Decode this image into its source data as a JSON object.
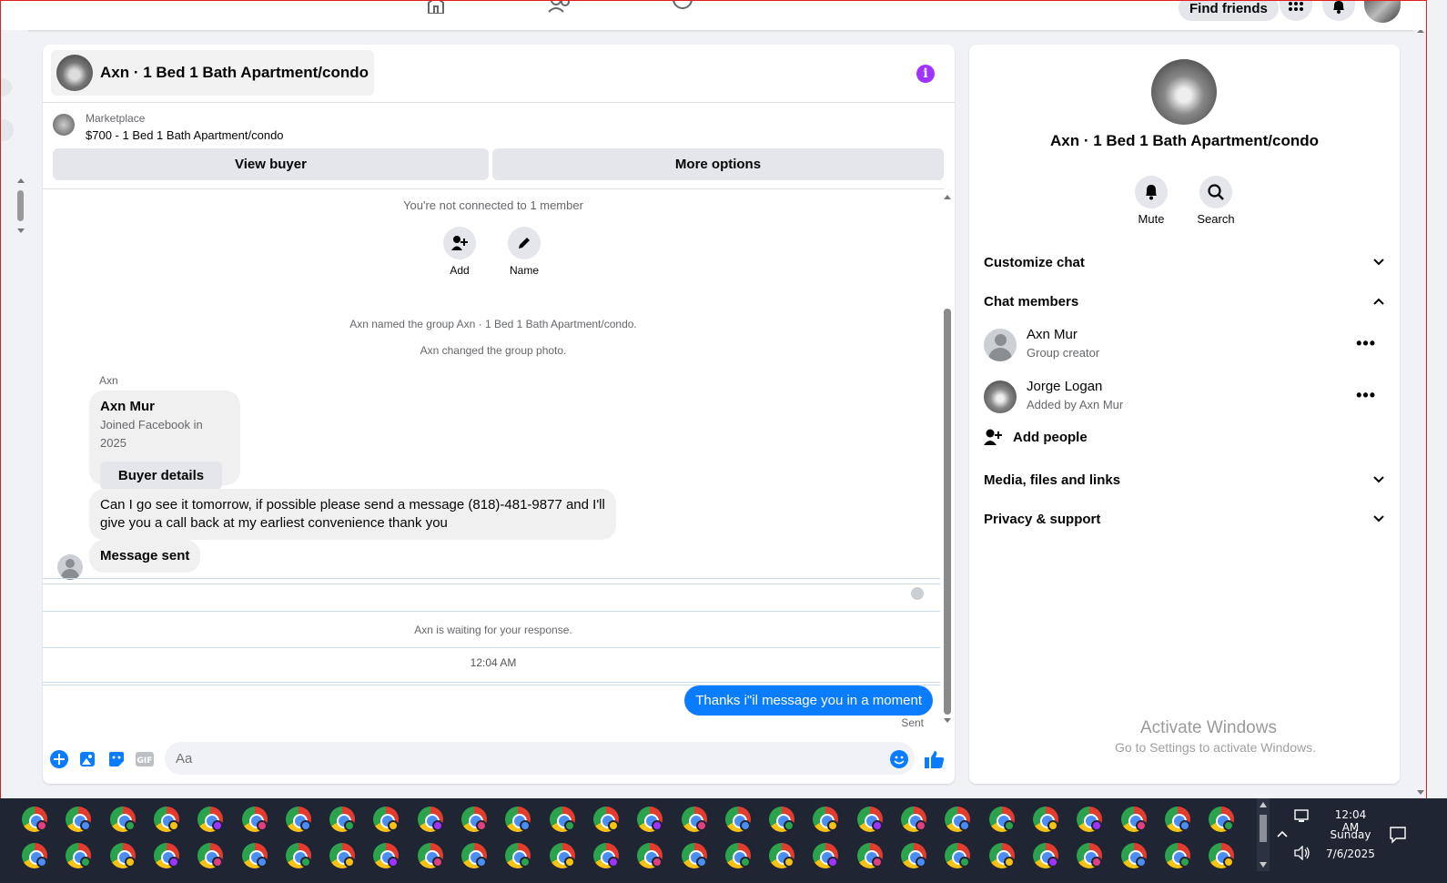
{
  "header": {
    "find_friends": "Find friends"
  },
  "chat": {
    "title": "Axn · 1 Bed 1 Bath Apartment/condo",
    "marketplace_label": "Marketplace",
    "listing": "$700 - 1 Bed 1 Bath Apartment/condo",
    "view_buyer": "View buyer",
    "more_options": "More options",
    "not_connected": "You're not connected to 1 member",
    "add_label": "Add",
    "name_label": "Name",
    "event_named": "Axn named the group Axn · 1 Bed 1 Bath Apartment/condo.",
    "event_photo": "Axn changed the group photo.",
    "sender": "Axn",
    "card_name": "Axn Mur",
    "card_sub": "Joined Facebook in 2025",
    "buyer_details": "Buyer details",
    "message_1": "Can I go see it tomorrow, if possible please send a message (818)-481-9877 and I'll give you a call back at my earliest convenience thank you",
    "message_2": "Message sent",
    "waiting": "Axn is waiting for your response.",
    "timestamp": "12:04 AM",
    "outgoing": "Thanks i\"il message you in a moment",
    "sent_status": "Sent",
    "composer_placeholder": "Aa"
  },
  "sidebar": {
    "title": "Axn · 1 Bed 1 Bath Apartment/condo",
    "mute": "Mute",
    "search": "Search",
    "customize": "Customize chat",
    "members_heading": "Chat members",
    "members": [
      {
        "name": "Axn Mur",
        "sub": "Group creator"
      },
      {
        "name": "Jorge Logan",
        "sub": "Added by Axn Mur"
      }
    ],
    "add_people": "Add people",
    "media": "Media, files and links",
    "privacy": "Privacy & support"
  },
  "watermark": {
    "line1": "Activate Windows",
    "line2": "Go to Settings to activate Windows."
  },
  "tray": {
    "time": "12:04 AM",
    "day": "Sunday",
    "date": "7/6/2025"
  },
  "colors": {
    "accent": "#0a7cff",
    "info": "#a033ff",
    "taskbar": "#1f2533"
  }
}
